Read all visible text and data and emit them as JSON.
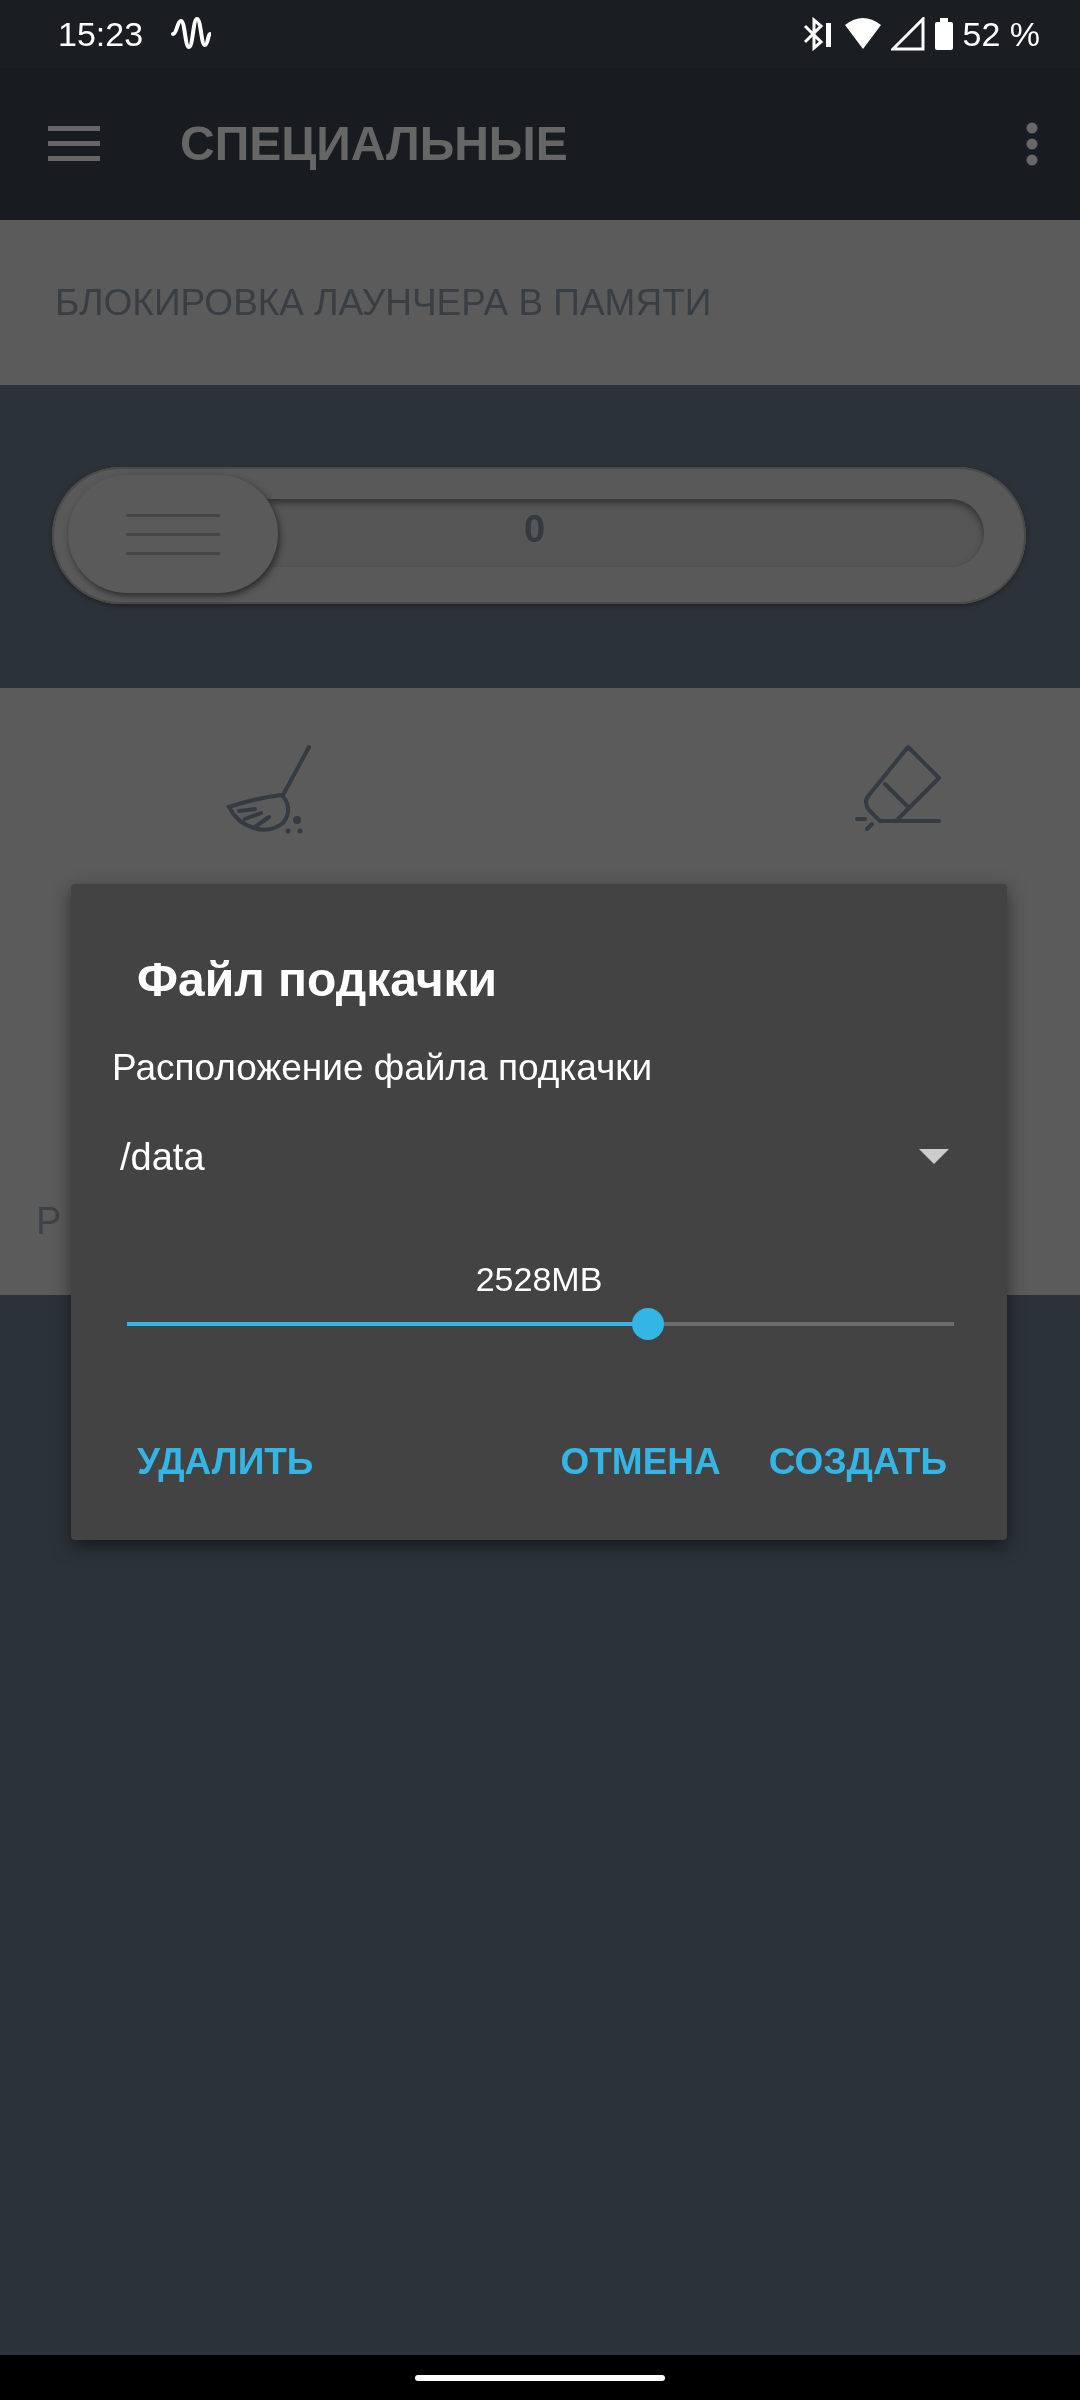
{
  "status_bar": {
    "time": "15:23",
    "battery": "52 %"
  },
  "toolbar": {
    "title": "СПЕЦИАЛЬНЫЕ"
  },
  "section": {
    "title": "БЛОКИРОВКА ЛАУНЧЕРА В ПАМЯТИ"
  },
  "swipe_slider": {
    "value": "0",
    "level": 0
  },
  "panel": {
    "partial_text": "Р"
  },
  "dialog": {
    "title": "Файл подкачки",
    "label": "Расположение файла подкачки",
    "dropdown": {
      "value": "/data"
    },
    "size": {
      "reading": "2528MB",
      "level": 0.63
    },
    "buttons": [
      {
        "label": "УДАЛИТЬ"
      },
      {
        "label": "ОТМЕНА"
      },
      {
        "label": "СОЗДАТЬ"
      }
    ]
  }
}
